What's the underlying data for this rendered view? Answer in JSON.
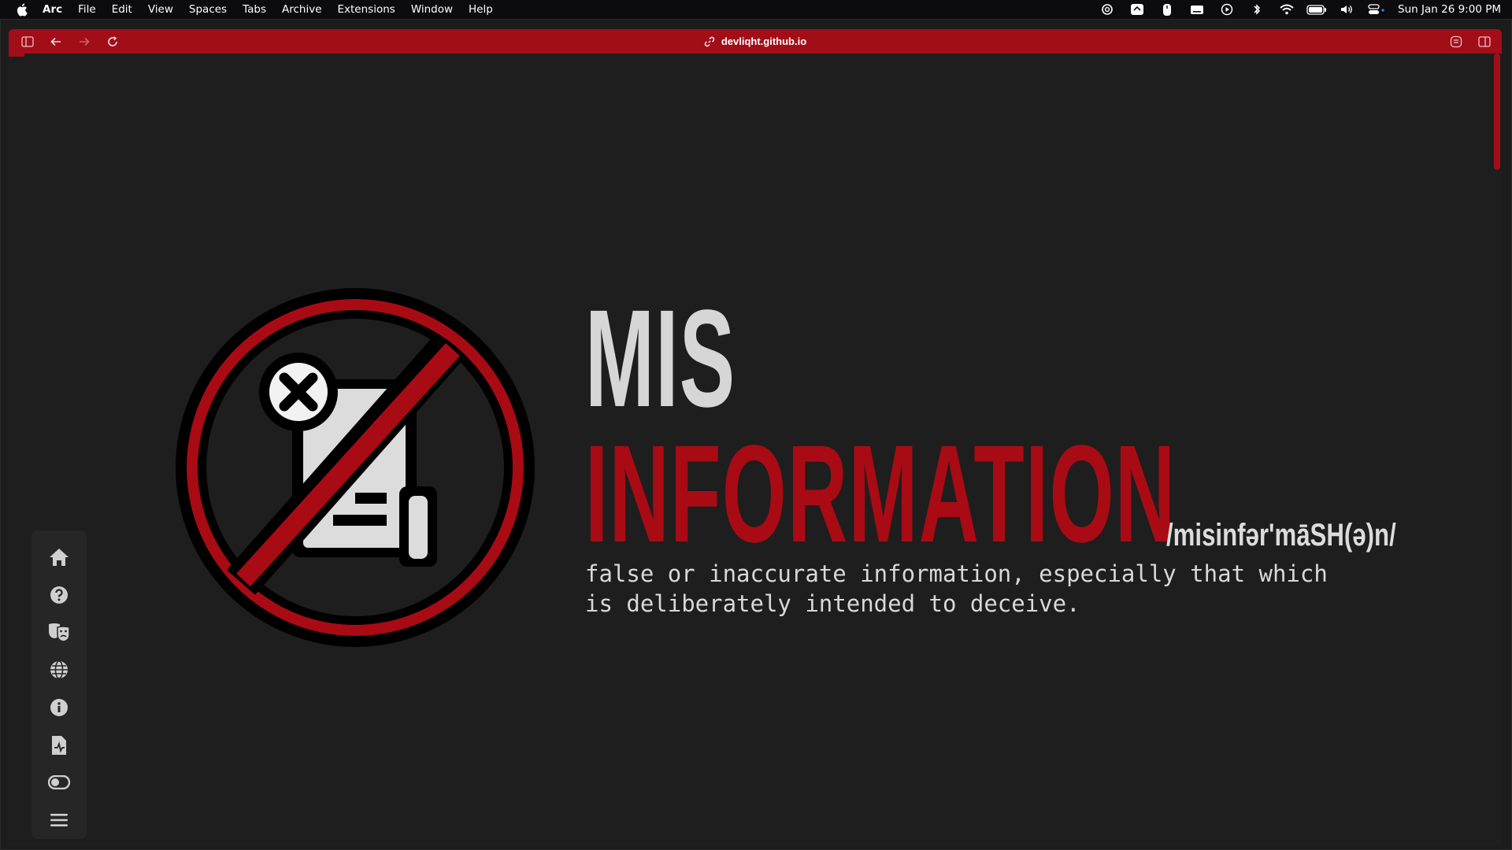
{
  "menubar": {
    "app_name": "Arc",
    "menus": [
      "File",
      "Edit",
      "View",
      "Spaces",
      "Tabs",
      "Archive",
      "Extensions",
      "Window",
      "Help"
    ],
    "status_icons": [
      "chatgpt-icon",
      "screen-mirror-icon",
      "mouse-icon",
      "keyboard-icon",
      "play-icon",
      "bluetooth-icon",
      "wifi-icon",
      "battery-icon",
      "volume-icon",
      "control-center-icon"
    ],
    "clock": "Sun Jan 26  9:00 PM"
  },
  "browser": {
    "url": "devliqht.github.io",
    "accent_color": "#a10e18"
  },
  "hero": {
    "title_line1": "MIS",
    "title_line2": "INFORMATION",
    "pronunciation": "/misinfər'māSH(ə)n/",
    "definition": "false or inaccurate information, especially that which is deliberately intended to deceive.",
    "colors": {
      "title_line1": "#d6d6d6",
      "title_line2": "#a80b14",
      "background": "#1e1e1e"
    }
  },
  "dock": {
    "items": [
      {
        "icon": "home-icon"
      },
      {
        "icon": "question-icon"
      },
      {
        "icon": "theater-masks-icon"
      },
      {
        "icon": "globe-icon"
      },
      {
        "icon": "info-icon"
      },
      {
        "icon": "file-chart-icon"
      },
      {
        "icon": "toggle-icon"
      },
      {
        "icon": "menu-icon"
      }
    ]
  }
}
